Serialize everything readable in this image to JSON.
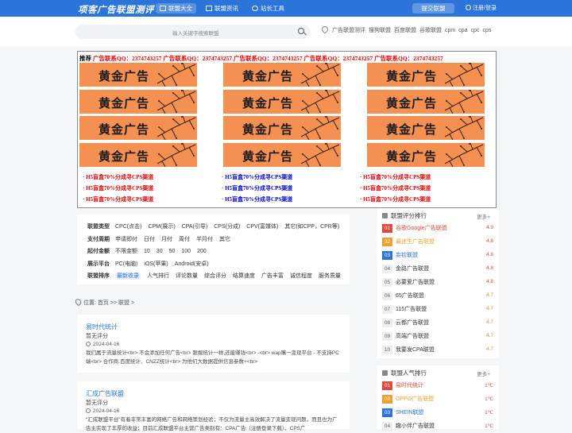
{
  "header": {
    "logo": "项客广告联盟测评",
    "nav": [
      {
        "label": "联盟大全",
        "active": true
      },
      {
        "label": "联盟资讯",
        "active": false
      },
      {
        "label": "站长工具",
        "active": false
      }
    ],
    "submit_label": "提交联盟",
    "login_label": "注册/登录"
  },
  "search": {
    "placeholder": "输入关键字搜索联盟",
    "hot_terms": [
      "广告联盟测评",
      "搜狗联盟",
      "百度联盟",
      "谷歌联盟",
      "cpm",
      "cpa",
      "cpc",
      "cps"
    ]
  },
  "ads": {
    "head_label": "推荐",
    "contact_text": "广告联系QQ：2374743257",
    "banner_text": "黄金广告",
    "h5_text": "H5盲盒70%分成寻CPS渠道",
    "colors": {
      "banner_bg": "#f39052",
      "contact": "#ee0000",
      "col1": "#e00000",
      "col2": "#0000cc",
      "col3": "#e00000"
    }
  },
  "filter": {
    "rows": [
      {
        "label": "联盟类型",
        "options": [
          "CPC(点击)",
          "CPM(展示)",
          "CPA(引导)",
          "CPS(分成)",
          "CPV(富媒体)",
          "其它(如CPP，CPR等)"
        ]
      },
      {
        "label": "支付周期",
        "options": [
          "申请即付",
          "日付",
          "月付",
          "周付",
          "半月付",
          "其它"
        ]
      },
      {
        "label": "起付金额",
        "options": [
          "不限金额",
          "10",
          "30",
          "50",
          "100",
          "200"
        ]
      },
      {
        "label": "展示平台",
        "options": [
          "PC(电脑)",
          "iOS(苹果)",
          "Android(安卓)"
        ]
      },
      {
        "label": "联盟排序",
        "options": [
          "最新收录",
          "人气排行",
          "评论数量",
          "综合评分",
          "结算速度",
          "广告丰富",
          "诚信程度",
          "服务质量"
        ],
        "selected": 0
      }
    ]
  },
  "breadcrumb": {
    "prefix": "位置:",
    "home": "首页",
    "sep": ">>",
    "current": "联盟",
    "tail": ">"
  },
  "cards": [
    {
      "title": "易时代统计",
      "score": "暂无评分",
      "date": "2024-04-16",
      "desc": "我们属于流量统计<br> 不会添加任何广告<br> 跟掘统计一样,还能赚钱<br> -<br> wap嘴一变现平台 - 不支持PC端<br> 合作商:百度统计、CNZZ统计<br> 为他们大数据提供信息参数+<br>"
    },
    {
      "title": "汇成广告联盟",
      "score": "暂无评分",
      "date": "2024-04-16",
      "desc": "\"汇成联盟平台\"有着非常丰富的网络广告和网络策划经验；不仅为流量主高效解决了流量变现问题，而且也为广告主实现了丰厚的收益；目前汇成联盟平台主营广告类别有：CPA广告（注册登录下载）、CPS广"
    }
  ],
  "rating_panel": {
    "title": "联盟评分排行",
    "more": "更多+",
    "items": [
      {
        "rank": "01",
        "name": "谷歌Google广告联盟",
        "value": "4.9"
      },
      {
        "rank": "02",
        "name": "最迷生广告联盟",
        "value": "4.8"
      },
      {
        "rank": "03",
        "name": "妄钦联盟",
        "value": "4.8"
      },
      {
        "rank": "04",
        "name": "金路广告联盟",
        "value": "4.8"
      },
      {
        "rank": "05",
        "name": "必要爱广告联盟",
        "value": "4.8"
      },
      {
        "rank": "06",
        "name": "65广告联盟",
        "value": "4.7"
      },
      {
        "rank": "07",
        "name": "115广告联盟",
        "value": "4.7"
      },
      {
        "rank": "08",
        "name": "云都广告联盟",
        "value": "4.7"
      },
      {
        "rank": "09",
        "name": "高端广告联盟",
        "value": "4.7"
      },
      {
        "rank": "10",
        "name": "我要发CPA联盟",
        "value": "4.7"
      }
    ]
  },
  "popular_panel": {
    "title": "联盟人气排行",
    "more": "更多+",
    "items": [
      {
        "rank": "01",
        "name": "易时代统计",
        "value": "1℃"
      },
      {
        "rank": "02",
        "name": "OPPO广告联盟",
        "value": "1℃"
      },
      {
        "rank": "03",
        "name": "SHEIN联盟",
        "value": "1℃"
      },
      {
        "rank": "04",
        "name": "趣小伴广告联盟",
        "value": "1℃"
      }
    ]
  }
}
